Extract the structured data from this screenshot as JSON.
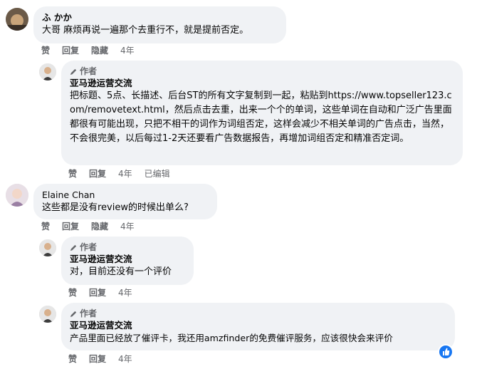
{
  "comments": [
    {
      "name": "ふ かか",
      "text": "大哥 麻烦再说一遍那个去重行不，就是提前否定。",
      "actions": {
        "like": "赞",
        "reply": "回复",
        "hide": "隐藏",
        "time": "4年"
      }
    },
    {
      "author_badge": "作者",
      "name": "亚马逊运营交流",
      "text": "把标题、5点、长描述、后台ST的所有文字复制到一起，粘贴到https://www.topseller123.com/removetext.html，然后点击去重，出来一个个的单词，这些单词在自动和广泛广告里面都很有可能出现，只把不相干的词作为词组否定，这样会减少不相关单词的广告点击，当然，不会很完美，以后每过1-2天还要看广告数据报告，再增加词组否定和精准否定词。",
      "actions": {
        "like": "赞",
        "reply": "回复",
        "time": "4年",
        "edited": "已编辑"
      }
    },
    {
      "name": "Elaine Chan",
      "text": "这些都是没有review的时候出单么?",
      "actions": {
        "like": "赞",
        "reply": "回复",
        "hide": "隐藏",
        "time": "4年"
      }
    },
    {
      "author_badge": "作者",
      "name": "亚马逊运营交流",
      "text": "对，目前还没有一个评价",
      "actions": {
        "like": "赞",
        "reply": "回复",
        "time": "4年"
      }
    },
    {
      "author_badge": "作者",
      "name": "亚马逊运营交流",
      "text": "产品里面已经放了催评卡，我还用amzfinder的免费催评服务，应该很快会来评价",
      "actions": {
        "like": "赞",
        "reply": "回复",
        "time": "4年"
      }
    }
  ],
  "icons": {
    "author": "pencil-icon",
    "reaction": "thumbs-up-icon"
  },
  "colors": {
    "bubble": "#f0f2f5",
    "secondary_text": "#65676b",
    "like_blue": "#1877f2"
  }
}
